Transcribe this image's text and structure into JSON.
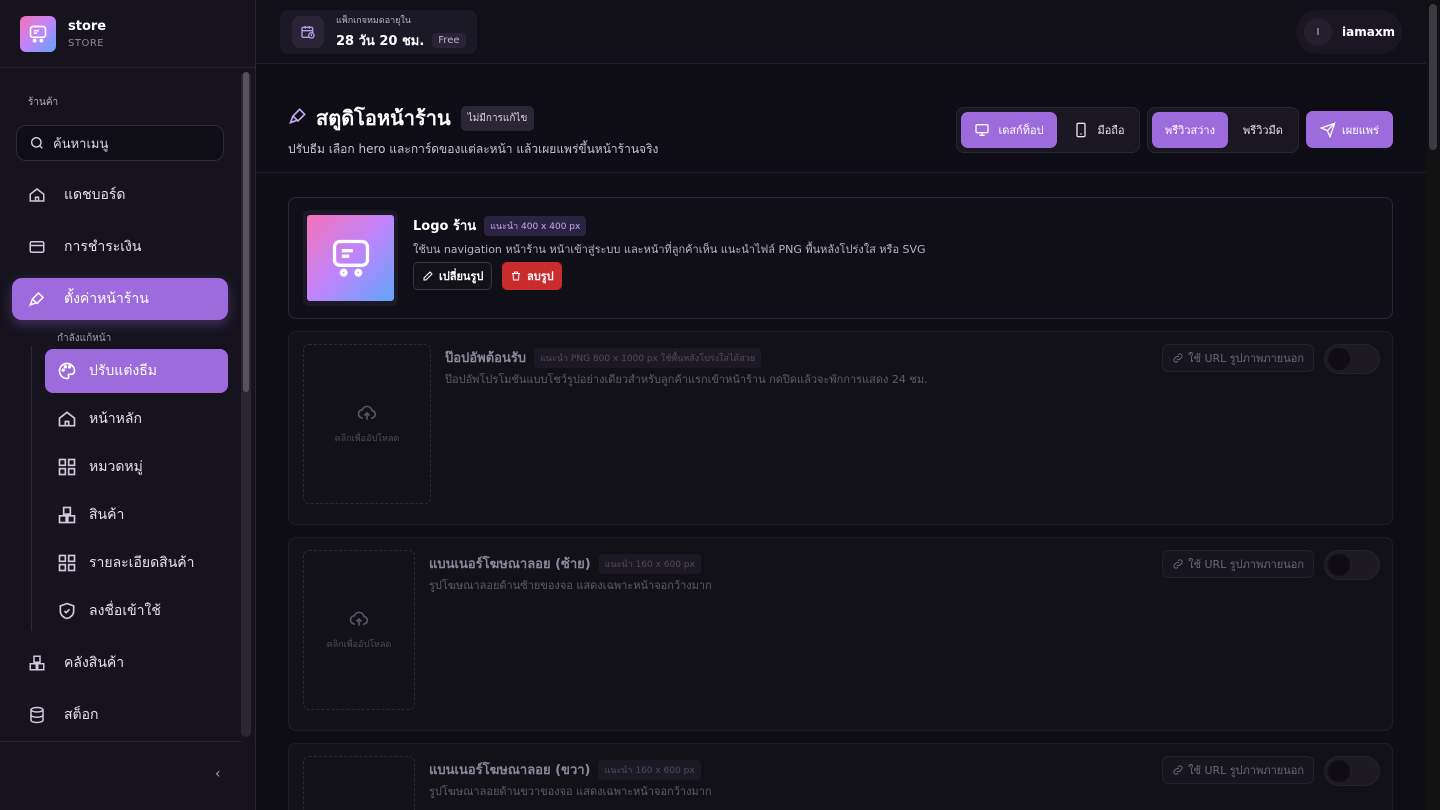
{
  "store": {
    "name": "store",
    "subtitle": "STORE"
  },
  "sidebar": {
    "section_label": "ร้านค้า",
    "search_placeholder": "ค้นหาเมนู",
    "items": [
      {
        "label": "แดชบอร์ด",
        "icon": "home-icon"
      },
      {
        "label": "การชำระเงิน",
        "icon": "credit-card-icon"
      },
      {
        "label": "ตั้งค่าหน้าร้าน",
        "icon": "brush-icon",
        "active": true
      },
      {
        "label": "คลังสินค้า",
        "icon": "boxes-icon"
      },
      {
        "label": "สต็อก",
        "icon": "database-icon"
      }
    ],
    "sub_caption": "กำลังแก้หน้า",
    "sub_items": [
      {
        "label": "ปรับแต่งธีม",
        "icon": "palette-icon",
        "active": true
      },
      {
        "label": "หน้าหลัก",
        "icon": "home-icon"
      },
      {
        "label": "หมวดหมู่",
        "icon": "grid-icon"
      },
      {
        "label": "สินค้า",
        "icon": "boxes-icon"
      },
      {
        "label": "รายละเอียดสินค้า",
        "icon": "grid-icon"
      },
      {
        "label": "ลงชื่อเข้าใช้",
        "icon": "shield-icon"
      }
    ],
    "collapse_glyph": "‹"
  },
  "topbar": {
    "package_label": "แพ็กเกจหมดอายุใน",
    "package_value": "28 วัน 20 ชม.",
    "package_tier": "Free",
    "user_initial": "I",
    "user_name": "iamaxm"
  },
  "page": {
    "title": "สตูดิโอหน้าร้าน",
    "badge": "ไม่มีการแก้ไข",
    "description": "ปรับธีม เลือก hero และการ์ดของแต่ละหน้า แล้วเผยแพร่ขึ้นหน้าร้านจริง",
    "device_desktop": "เดสก์ท็อป",
    "device_mobile": "มือถือ",
    "preview_light": "พรีวิวสว่าง",
    "preview_dark": "พรีวิวมืด",
    "publish": "เผยแพร่"
  },
  "cards": {
    "logo": {
      "title": "Logo ร้าน",
      "recommend": "แนะนำ 400 x 400 px",
      "description": "ใช้บน navigation หน้าร้าน หน้าเข้าสู่ระบบ และหน้าที่ลูกค้าเห็น แนะนำไฟล์ PNG พื้นหลังโปร่งใส หรือ SVG",
      "change_label": "เปลี่ยนรูป",
      "delete_label": "ลบรูป"
    },
    "popup": {
      "title": "ป๊อปอัพต้อนรับ",
      "recommend": "แนะนำ PNG 800 x 1000 px ใช้พื้นหลังโปร่งใสได้สวย",
      "description": "ป๊อปอัพโปรโมชันแบบโชว์รูปอย่างเดียวสำหรับลูกค้าแรกเข้าหน้าร้าน กดปิดแล้วจะพักการแสดง 24 ชม.",
      "upload_label": "คลิกเพื่ออัปโหลด",
      "url_label": "ใช้ URL รูปภาพภายนอก",
      "enabled": false
    },
    "banner_left": {
      "title": "แบนเนอร์โฆษณาลอย (ซ้าย)",
      "recommend": "แนะนำ 160 x 600 px",
      "description": "รูปโฆษณาลอยด้านซ้ายของจอ แสดงเฉพาะหน้าจอกว้างมาก",
      "upload_label": "คลิกเพื่ออัปโหลด",
      "url_label": "ใช้ URL รูปภาพภายนอก",
      "enabled": false
    },
    "banner_right": {
      "title": "แบนเนอร์โฆษณาลอย (ขวา)",
      "recommend": "แนะนำ 160 x 600 px",
      "description": "รูปโฆษณาลอยด้านขวาของจอ แสดงเฉพาะหน้าจอกว้างมาก",
      "url_label": "ใช้ URL รูปภาพภายนอก",
      "enabled": false
    }
  },
  "colors": {
    "accent": "#9d6bdc",
    "danger": "#c92c2c",
    "background": "#0e0c14"
  }
}
